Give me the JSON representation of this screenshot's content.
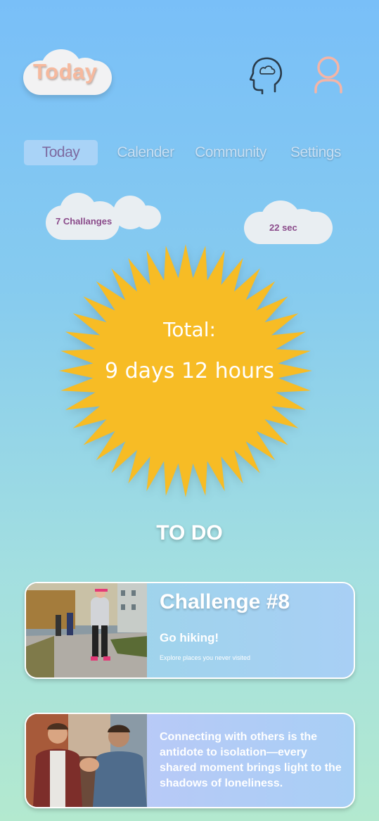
{
  "header": {
    "logo_text": "Today"
  },
  "icons": {
    "mind": "head-cloud-icon",
    "profile": "user-icon"
  },
  "nav": [
    {
      "label": "Today",
      "active": true
    },
    {
      "label": "Calender",
      "active": false
    },
    {
      "label": "Community",
      "active": false
    },
    {
      "label": "Settings",
      "active": false
    }
  ],
  "stats": {
    "challenges": "7 Challanges",
    "timer": "22 sec"
  },
  "sun": {
    "total_label": "Total:",
    "total_value": "9 days 12 hours"
  },
  "todo": {
    "heading": "TO DO"
  },
  "cards": [
    {
      "title": "Challenge #8",
      "subtitle": "Go hiking!",
      "description": "Explore places you never visited"
    },
    {
      "quote": "Connecting with others is the antidote to isolation—every shared moment brings light to the shadows of loneliness."
    }
  ],
  "colors": {
    "sun": "#f7bc25",
    "accent_text": "#7d6aa0"
  }
}
